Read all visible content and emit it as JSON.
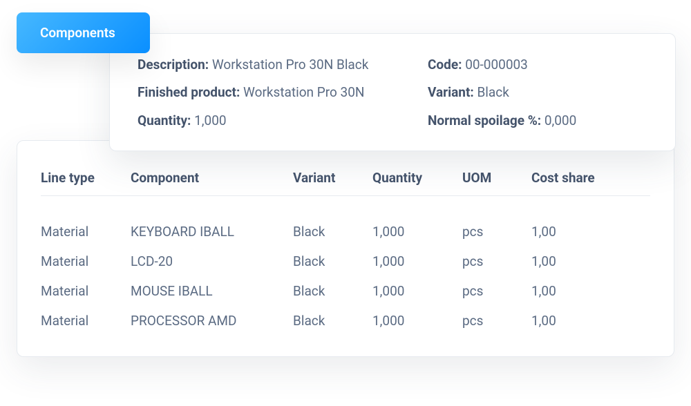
{
  "tab": {
    "label": "Components"
  },
  "info": {
    "fields": {
      "description": {
        "label": "Description:",
        "value": "Workstation Pro 30N Black"
      },
      "code": {
        "label": "Code:",
        "value": "00-000003"
      },
      "finished_product": {
        "label": "Finished product:",
        "value": "Workstation Pro 30N"
      },
      "variant": {
        "label": "Variant:",
        "value": "Black"
      },
      "quantity": {
        "label": "Quantity:",
        "value": "1,000"
      },
      "normal_spoilage": {
        "label": "Normal spoilage %:",
        "value": "0,000"
      }
    }
  },
  "table": {
    "columns": {
      "line_type": "Line type",
      "component": "Component",
      "variant": "Variant",
      "quantity": "Quantity",
      "uom": "UOM",
      "cost_share": "Cost share"
    },
    "rows": [
      {
        "line_type": "Material",
        "component": "KEYBOARD IBALL",
        "variant": "Black",
        "quantity": "1,000",
        "uom": "pcs",
        "cost_share": "1,00"
      },
      {
        "line_type": "Material",
        "component": "LCD-20",
        "variant": "Black",
        "quantity": "1,000",
        "uom": "pcs",
        "cost_share": "1,00"
      },
      {
        "line_type": "Material",
        "component": "MOUSE IBALL",
        "variant": "Black",
        "quantity": "1,000",
        "uom": "pcs",
        "cost_share": "1,00"
      },
      {
        "line_type": "Material",
        "component": "PROCESSOR AMD",
        "variant": "Black",
        "quantity": "1,000",
        "uom": "pcs",
        "cost_share": "1,00"
      }
    ]
  }
}
